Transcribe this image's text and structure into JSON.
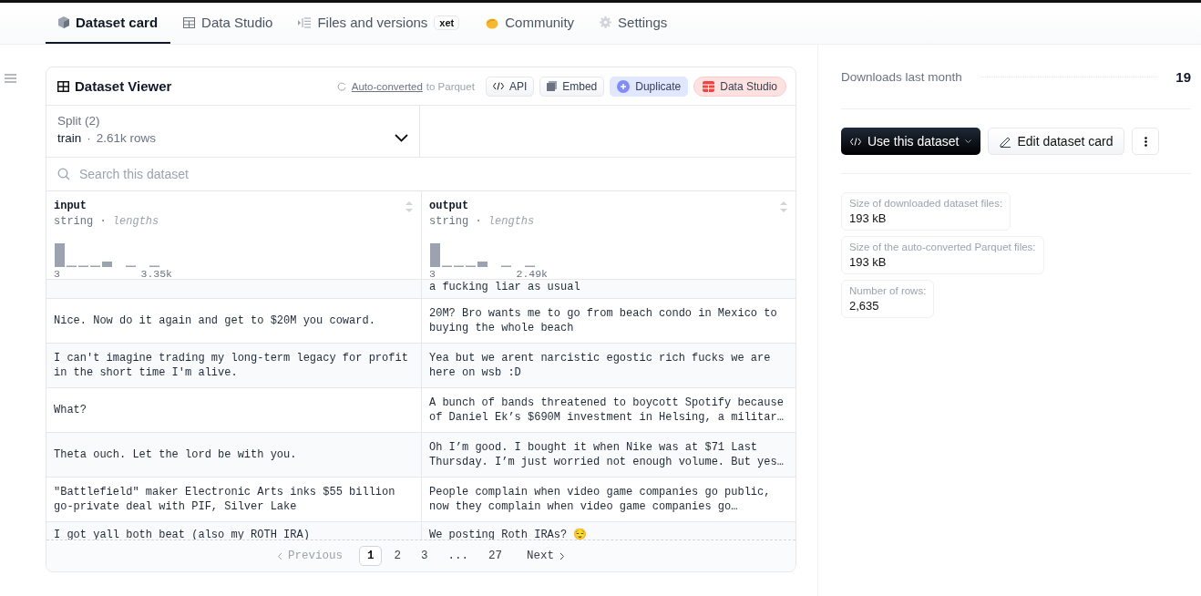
{
  "tabs": [
    {
      "label": "Dataset card",
      "selected": true
    },
    {
      "label": "Data Studio",
      "selected": false
    },
    {
      "label": "Files and versions",
      "badge": "xet",
      "selected": false
    },
    {
      "label": "Community",
      "selected": false
    },
    {
      "label": "Settings",
      "selected": false
    }
  ],
  "viewer": {
    "title": "Dataset Viewer",
    "converted_link": "Auto-converted",
    "converted_rest": "to Parquet",
    "buttons": [
      {
        "label": "API",
        "kind": "api"
      },
      {
        "label": "Embed",
        "kind": "embed"
      },
      {
        "label": "Duplicate",
        "kind": "duplicate"
      },
      {
        "label": "Data Studio",
        "kind": "studio"
      }
    ],
    "split": {
      "label": "Split (2)",
      "name": "train",
      "separator": "·",
      "rows": "2.61k rows"
    },
    "search": {
      "placeholder": "Search this dataset"
    },
    "columns": [
      {
        "name": "input",
        "type": "string",
        "separator": "·",
        "stat": "lengths",
        "min": "3",
        "max": "3.35k"
      },
      {
        "name": "output",
        "type": "string",
        "separator": "·",
        "stat": "lengths",
        "min": "3",
        "max": "2.49k"
      }
    ],
    "rows": [
      [
        "",
        "a fucking liar as usual"
      ],
      [
        "Nice. Now do it again and get to $20M you coward.",
        "20M? Bro wants me to go from beach condo in Mexico to buying the whole beach"
      ],
      [
        "I can't imagine trading my long-term legacy for profit in the short time I'm alive.",
        "Yea but we arent narcistic egostic rich fucks we are here on wsb :D"
      ],
      [
        "What?",
        "A bunch of bands threatened to boycott Spotify because of Daniel Ek’s $690M investment in Helsing, a militar…"
      ],
      [
        "Theta ouch. Let the lord be with you.",
        "Oh I’m good. I bought it when Nike was at $71 Last Thursday. I’m just worried not enough volume. But yes…"
      ],
      [
        "\"Battlefield\" maker Electronic Arts inks $55 billion go-private deal with PIF, Silver Lake",
        "People complain when video game companies go public, now they complain when video game companies go…"
      ],
      [
        "I got yall both beat (also my ROTH IRA)",
        "We posting Roth IRAs? 😌"
      ]
    ],
    "pagination": {
      "previous": "Previous",
      "next": "Next",
      "pages": [
        {
          "label": "1",
          "selected": true
        },
        {
          "label": "2",
          "selected": false
        },
        {
          "label": "3",
          "selected": false
        },
        {
          "label": "...",
          "selected": false
        },
        {
          "label": "27",
          "selected": false
        }
      ]
    }
  },
  "sidebar": {
    "downloads_label": "Downloads last month",
    "downloads": "19",
    "use_button": "Use this dataset",
    "edit_button": "Edit dataset card",
    "stats": [
      {
        "label": "Size of downloaded dataset files:",
        "value": "193 kB"
      },
      {
        "label": "Size of the auto-converted Parquet files:",
        "value": "193 kB"
      },
      {
        "label": "Number of rows:",
        "value": "2,635"
      }
    ]
  }
}
